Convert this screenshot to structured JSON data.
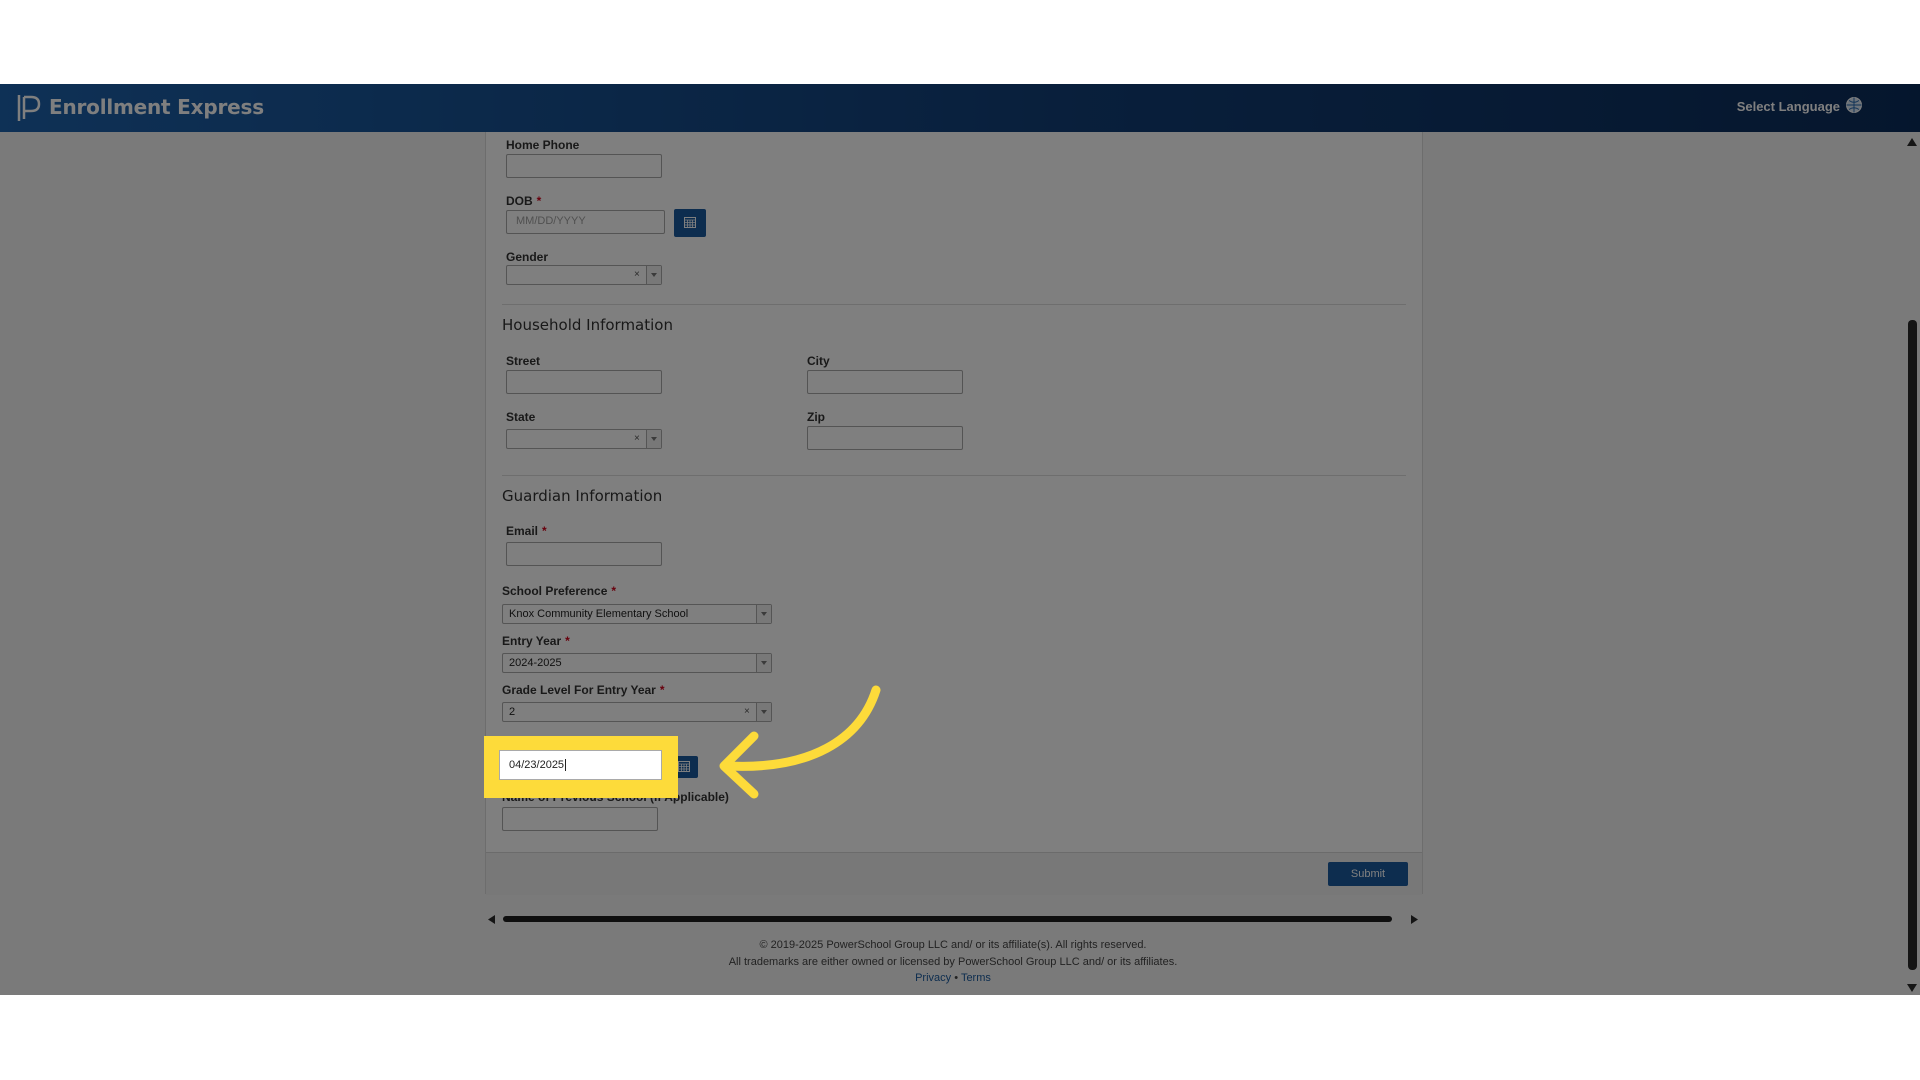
{
  "header": {
    "app_title": "Enrollment Express",
    "select_language": "Select Language",
    "logo_icon": "powerschool-logo-icon",
    "globe_icon": "globe-icon"
  },
  "form": {
    "home_phone": {
      "label": "Home Phone",
      "value": ""
    },
    "dob": {
      "label": "DOB",
      "required_mark": "*",
      "placeholder": "MM/DD/YYYY",
      "value": ""
    },
    "gender": {
      "label": "Gender",
      "value": "",
      "clear": "×"
    },
    "household_section": "Household Information",
    "street": {
      "label": "Street",
      "value": ""
    },
    "city": {
      "label": "City",
      "value": ""
    },
    "state": {
      "label": "State",
      "value": "",
      "clear": "×"
    },
    "zip": {
      "label": "Zip",
      "value": ""
    },
    "guardian_section": "Guardian Information",
    "email": {
      "label": "Email",
      "required_mark": "*",
      "value": ""
    },
    "school_preference": {
      "label": "School Preference",
      "required_mark": "*",
      "value": "Knox Community Elementary School"
    },
    "entry_year": {
      "label": "Entry Year",
      "required_mark": "*",
      "value": "2024-2025"
    },
    "grade_level": {
      "label": "Grade Level For Entry Year",
      "required_mark": "*",
      "value": "2",
      "clear": "×"
    },
    "date_field": {
      "value": "04/23/2025"
    },
    "previous_school": {
      "label": "Name of Previous School (If Applicable)",
      "value": ""
    },
    "submit_label": "Submit"
  },
  "footer": {
    "copyright": "© 2019-2025 PowerSchool Group LLC and/ or its affiliate(s). All rights reserved.",
    "trademarks": "All trademarks are either owned or licensed by PowerSchool Group LLC and/ or its affiliates.",
    "privacy": "Privacy",
    "separator": "•",
    "terms": "Terms"
  },
  "colors": {
    "header_blue": "#1d62ac",
    "button_blue": "#1a5a9e",
    "highlight_yellow": "#fddb3a",
    "required_red": "#d0021b"
  }
}
